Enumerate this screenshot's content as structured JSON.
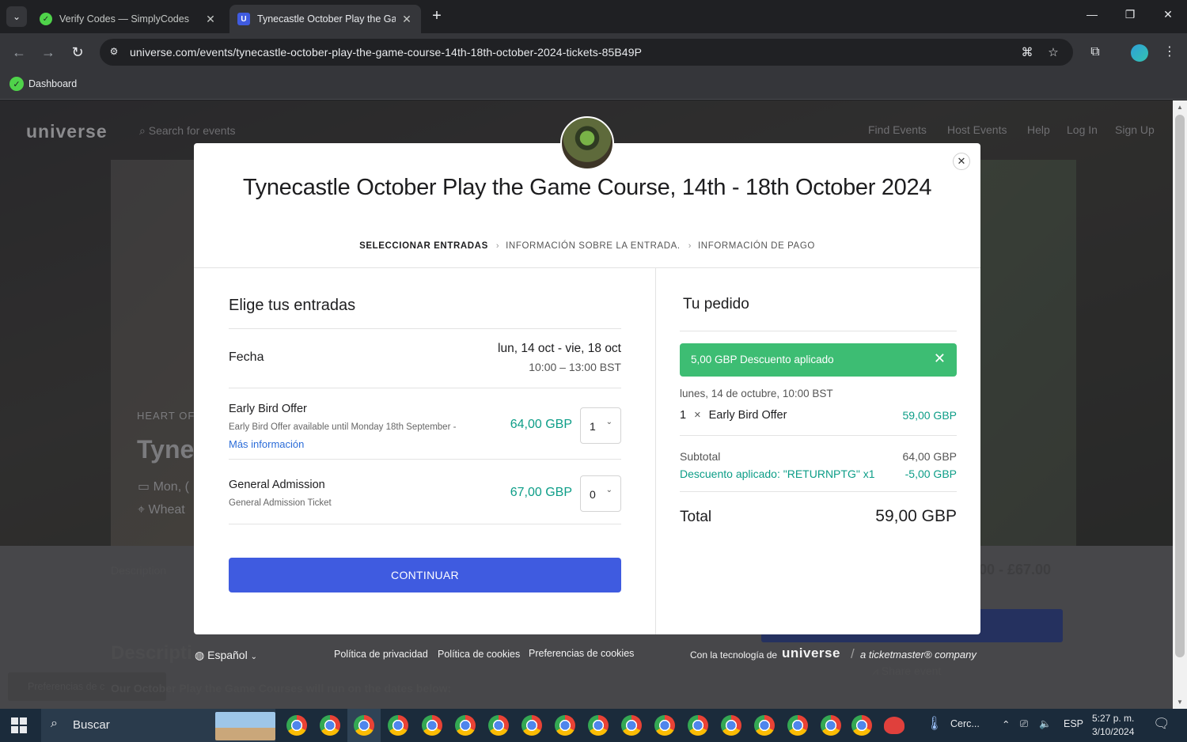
{
  "browser": {
    "tabs": [
      {
        "title": "Verify Codes — SimplyCodes",
        "favicon_color": "#4fd34a",
        "active": false
      },
      {
        "title": "Tynecastle October Play the Game Course, 14th - 18th October 2024",
        "favicon_letter": "U",
        "favicon_color": "#3f5be0",
        "active": true
      }
    ],
    "url": "universe.com/events/tynecastle-october-play-the-game-course-14th-18th-october-2024-tickets-85B49P",
    "bookmarks": [
      {
        "label": "Dashboard"
      }
    ]
  },
  "background_page": {
    "logo": "universe",
    "search_placeholder": "Search for events",
    "nav": [
      "Find Events",
      "Host Events",
      "Help",
      "Log In",
      "Sign Up"
    ],
    "hero_kicker": "HEART OF",
    "hero_title_fragment": "Tyne",
    "hero_date_fragment": "Mon, (",
    "hero_place_fragment": "Wheat",
    "description_tab": "Description",
    "price_range_fragment": "00 - £67.00",
    "description_heading_fragment": "Descripti",
    "description_body_fragment": "Our October Play the Game Courses will run on the dates below:",
    "cookie_pref_fragment": "Preferencias de c",
    "share_label": "Share event"
  },
  "modal": {
    "event_title": "Tynecastle October Play the Game Course, 14th - 18th October 2024",
    "steps": [
      "SELECCIONAR ENTRADAS",
      "INFORMACIÓN SOBRE LA ENTRADA.",
      "INFORMACIÓN DE PAGO"
    ],
    "ticket_section": {
      "heading": "Elige tus entradas",
      "date_label": "Fecha",
      "date_value": "lun, 14 oct - vie, 18 oct",
      "time_value": "10:00 – 13:00 BST",
      "tickets": [
        {
          "name": "Early Bird Offer",
          "description": "Early Bird Offer available until Monday 18th September -",
          "link": "Más información",
          "price": "64,00 GBP",
          "quantity": "1"
        },
        {
          "name": "General Admission",
          "description": "General Admission Ticket",
          "price": "67,00 GBP",
          "quantity": "0"
        }
      ],
      "continue_label": "CONTINUAR"
    },
    "order": {
      "heading": "Tu pedido",
      "discount_banner": "5,00 GBP Descuento aplicado",
      "date_line": "lunes, 14 de octubre, 10:00 BST",
      "line_qty": "1",
      "line_times": "×",
      "line_name": "Early Bird Offer",
      "line_price": "59,00 GBP",
      "subtotal_label": "Subtotal",
      "subtotal_value": "64,00 GBP",
      "discount_label": "Descuento aplicado: \"RETURNPTG\" x1",
      "discount_value": "-5,00 GBP",
      "total_label": "Total",
      "total_value": "59,00 GBP"
    }
  },
  "footer": {
    "language": "Español",
    "links": [
      "Política de privacidad",
      "Política de cookies",
      "Preferencias de cookies"
    ],
    "powered_by": "Con la tecnología de",
    "brand": "universe",
    "ticketmaster": "a ticketmaster® company"
  },
  "taskbar": {
    "search_label": "Buscar",
    "weather": "Cerc...",
    "lang": "ESP",
    "time": "5:27 p. m.",
    "date": "3/10/2024"
  },
  "colors": {
    "accent_blue": "#3f5be0",
    "price_teal": "#0c9d87",
    "discount_green": "#3dbd73"
  }
}
